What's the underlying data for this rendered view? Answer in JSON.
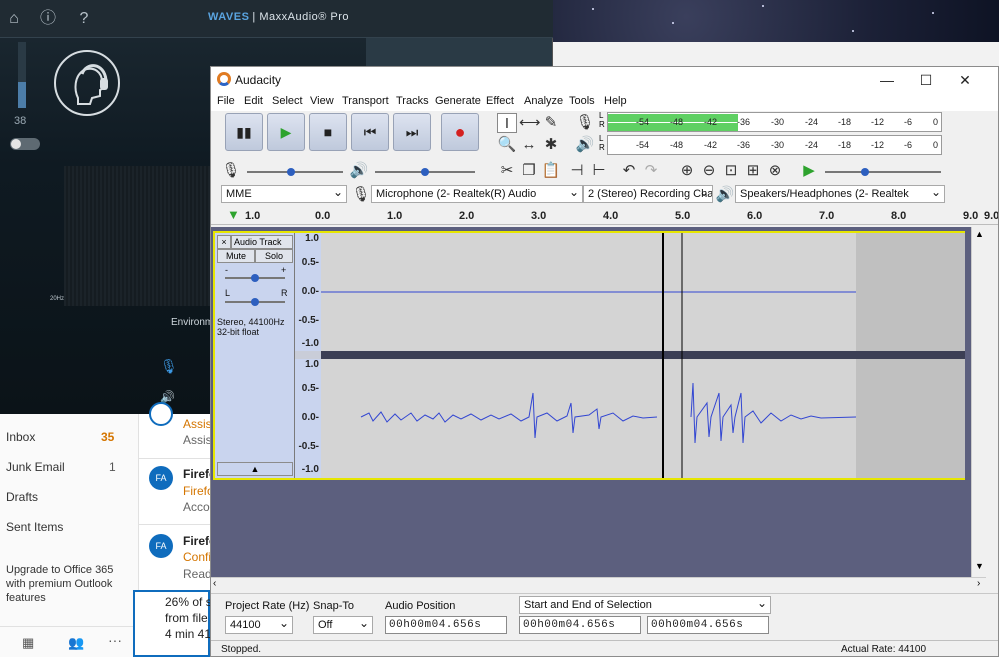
{
  "waves": {
    "title_brand": "WAVES",
    "title_text": "MaxxAudio® Pro",
    "volume_value": "38",
    "freq_label": "20Hz",
    "env_label": "Environm"
  },
  "outlook": {
    "folders": [
      {
        "name": "Inbox",
        "count": "35"
      },
      {
        "name": "Junk Email",
        "count": "1"
      },
      {
        "name": "Drafts",
        "count": ""
      },
      {
        "name": "Sent Items",
        "count": ""
      }
    ],
    "upgrade_text": "Upgrade to Office 365 with premium Outlook features",
    "messages": [
      {
        "avatar": "",
        "from": "",
        "subject": "Assis",
        "preview": "Assist"
      },
      {
        "avatar": "FA",
        "from": "Firefo",
        "subject": "Firefo",
        "preview": "Accou"
      },
      {
        "avatar": "FA",
        "from": "Firefo",
        "subject": "Confi",
        "preview": "Ready"
      }
    ],
    "progress_lines": [
      "26% of s",
      "from file",
      "4 min 41"
    ]
  },
  "audacity": {
    "title": "Audacity",
    "menu": [
      "File",
      "Edit",
      "Select",
      "View",
      "Transport",
      "Tracks",
      "Generate",
      "Effect",
      "Analyze",
      "Tools",
      "Help"
    ],
    "meter_ticks": [
      "-54",
      "-48",
      "-42",
      "-36",
      "-30",
      "-24",
      "-18",
      "-12",
      "-6",
      "0"
    ],
    "meter_level": 0.39,
    "meter_lr": [
      "L",
      "R"
    ],
    "host": "MME",
    "recording_device": "Microphone (2- Realtek(R) Audio",
    "channels": "2 (Stereo) Recording Chan",
    "playback_device": "Speakers/Headphones (2- Realtek",
    "ruler_ticks": [
      "1.0",
      "0.0",
      "1.0",
      "2.0",
      "3.0",
      "4.0",
      "5.0",
      "6.0",
      "7.0",
      "8.0",
      "9.0",
      "9.0"
    ],
    "track": {
      "close": "×",
      "name": "Audio Track",
      "mute": "Mute",
      "solo": "Solo",
      "gain_minus": "-",
      "gain_plus": "+",
      "pan_l": "L",
      "pan_r": "R",
      "info_line1": "Stereo, 44100Hz",
      "info_line2": "32-bit float",
      "y_labels": [
        "1.0",
        "0.5-",
        "0.0-",
        "-0.5-",
        "-1.0"
      ]
    },
    "project_rate_label": "Project Rate (Hz)",
    "project_rate": "44100",
    "snap_to_label": "Snap-To",
    "snap_to": "Off",
    "audio_position_label": "Audio Position",
    "audio_position": "00h00m04.656s",
    "selection_mode": "Start and End of Selection",
    "selection_start": "00h00m04.656s",
    "selection_end": "00h00m04.656s",
    "status": "Stopped.",
    "actual_rate": "Actual Rate: 44100"
  }
}
